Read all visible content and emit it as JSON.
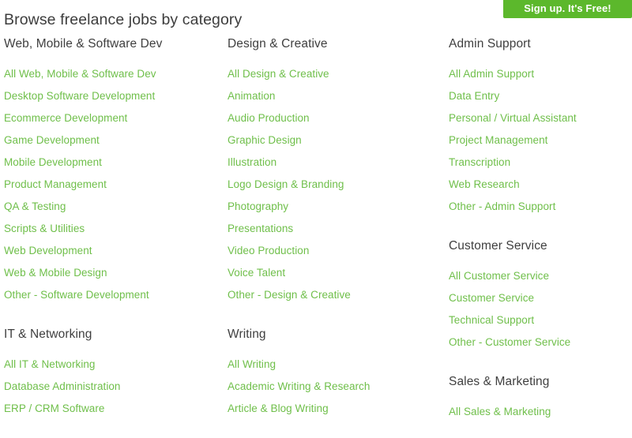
{
  "header": {
    "title": "Browse freelance jobs by category",
    "signup_label": "Sign up. It's Free!",
    "button_color": "#5cb82c",
    "title_color": "#3d3d3d"
  },
  "theme": {
    "link_color": "#6fbf4a",
    "heading_color": "#3f3f3f",
    "background": "#ffffff"
  },
  "columns": [
    {
      "groups": [
        {
          "heading": "Web, Mobile & Software Dev",
          "links": [
            "All Web, Mobile & Software Dev",
            "Desktop Software Development",
            "Ecommerce Development",
            "Game Development",
            "Mobile Development",
            "Product Management",
            "QA & Testing",
            "Scripts & Utilities",
            "Web Development",
            "Web & Mobile Design",
            "Other - Software Development"
          ]
        },
        {
          "heading": "IT & Networking",
          "links": [
            "All IT & Networking",
            "Database Administration",
            "ERP / CRM Software"
          ]
        }
      ]
    },
    {
      "groups": [
        {
          "heading": "Design & Creative",
          "links": [
            "All Design & Creative",
            "Animation",
            "Audio Production",
            "Graphic Design",
            "Illustration",
            "Logo Design & Branding",
            "Photography",
            "Presentations",
            "Video Production",
            "Voice Talent",
            "Other - Design & Creative"
          ]
        },
        {
          "heading": "Writing",
          "links": [
            "All Writing",
            "Academic Writing & Research",
            "Article & Blog Writing"
          ]
        }
      ]
    },
    {
      "groups": [
        {
          "heading": "Admin Support",
          "links": [
            "All Admin Support",
            "Data Entry",
            "Personal / Virtual Assistant",
            "Project Management",
            "Transcription",
            "Web Research",
            "Other - Admin Support"
          ]
        },
        {
          "heading": "Customer Service",
          "links": [
            "All Customer Service",
            "Customer Service",
            "Technical Support",
            "Other - Customer Service"
          ]
        },
        {
          "heading": "Sales & Marketing",
          "links": [
            "All Sales & Marketing"
          ]
        }
      ]
    }
  ]
}
